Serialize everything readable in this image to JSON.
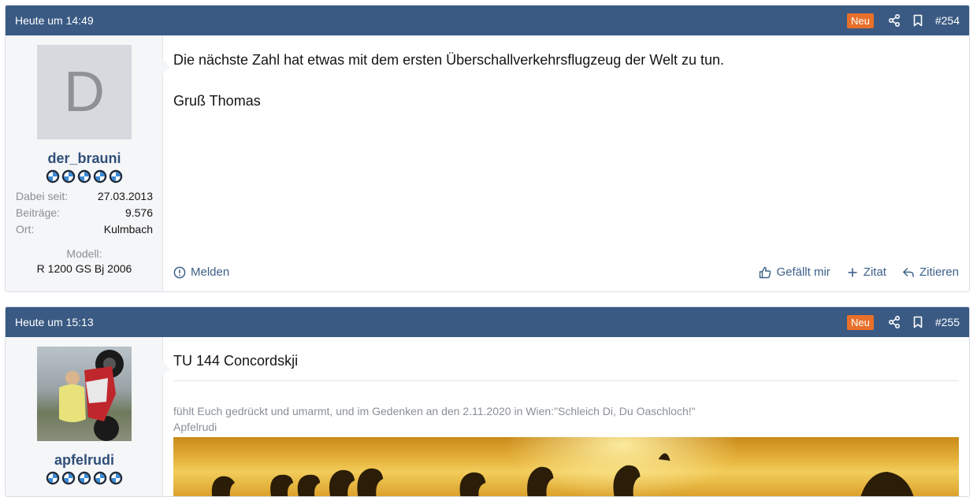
{
  "posts": [
    {
      "date": "Heute um 14:49",
      "badge": "Neu",
      "number": "#254",
      "user": {
        "avatar_letter": "D",
        "name": "der_brauni",
        "stats": [
          {
            "label": "Dabei seit:",
            "value": "27.03.2013"
          },
          {
            "label": "Beiträge:",
            "value": "9.576"
          },
          {
            "label": "Ort:",
            "value": "Kulmbach"
          }
        ],
        "model_label": "Modell:",
        "model_value": "R 1200 GS Bj 2006"
      },
      "message": [
        "Die nächste Zahl hat etwas mit dem ersten Überschallverkehrsflugzeug der Welt zu tun.",
        "Gruß Thomas"
      ],
      "actions": {
        "report": "Melden",
        "like": "Gefällt mir",
        "quote_plus": "Zitat",
        "reply": "Zitieren"
      }
    },
    {
      "date": "Heute um 15:13",
      "badge": "Neu",
      "number": "#255",
      "user": {
        "name": "apfelrudi"
      },
      "message": [
        "TU 144 Concordskji"
      ],
      "signature": [
        "fühlt Euch gedrückt und umarmt, und im Gedenken an den 2.11.2020 in Wien:\"Schleich Di, Du Oaschloch!\"",
        "Apfelrudi"
      ]
    }
  ],
  "colors": {
    "header": "#3a5a83",
    "badge": "#e8702a",
    "username": "#2f4f78",
    "action": "#3c5f8a"
  },
  "icons": [
    "share-icon",
    "bookmark-icon",
    "report-icon",
    "thumbs-up-icon",
    "plus-icon",
    "reply-icon",
    "rank-roundel-icon"
  ]
}
